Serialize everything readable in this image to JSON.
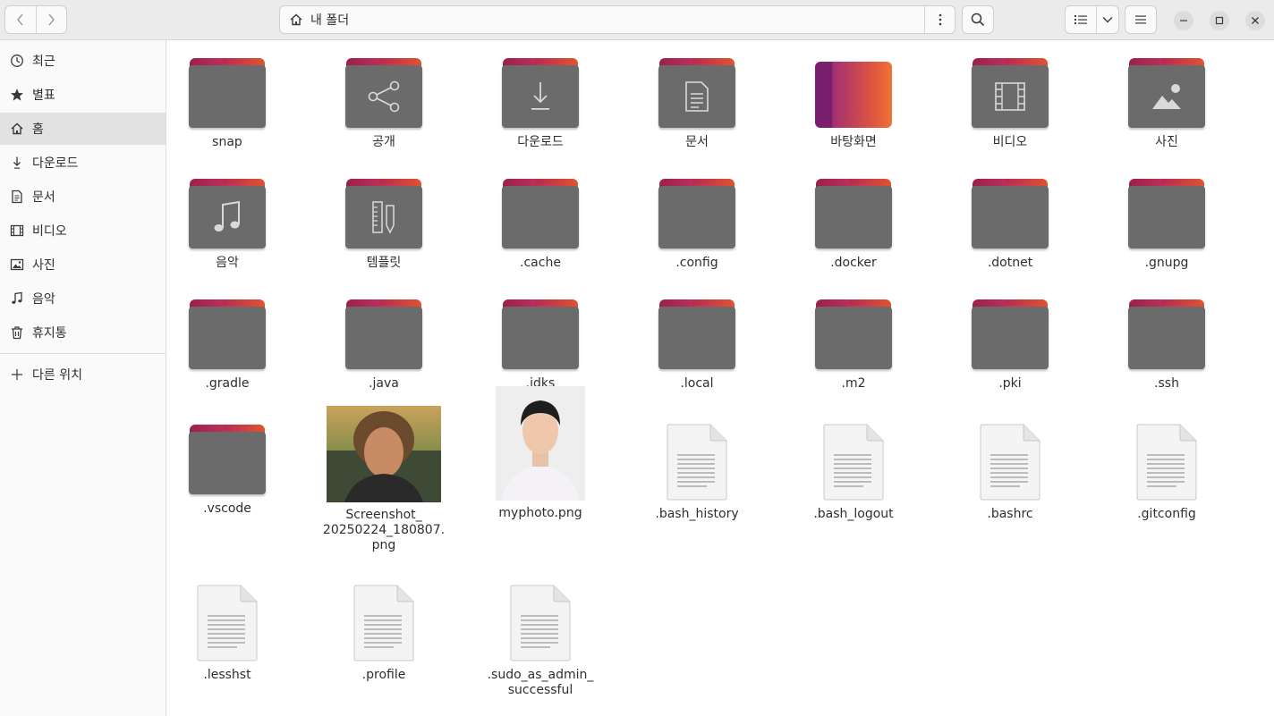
{
  "window": {
    "path_label": "내 폴더"
  },
  "sidebar": {
    "items": [
      {
        "label": "최근",
        "icon": "clock-icon"
      },
      {
        "label": "별표",
        "icon": "star-icon"
      },
      {
        "label": "홈",
        "icon": "home-icon"
      },
      {
        "label": "다운로드",
        "icon": "download-icon"
      },
      {
        "label": "문서",
        "icon": "document-icon"
      },
      {
        "label": "비디오",
        "icon": "video-icon"
      },
      {
        "label": "사진",
        "icon": "picture-icon"
      },
      {
        "label": "음악",
        "icon": "music-icon"
      },
      {
        "label": "휴지통",
        "icon": "trash-icon"
      }
    ],
    "other_locations": "다른 위치",
    "active_index": 2
  },
  "files": [
    {
      "name": "snap",
      "kind": "folder",
      "emblem": ""
    },
    {
      "name": "공개",
      "kind": "folder",
      "emblem": "share-icon"
    },
    {
      "name": "다운로드",
      "kind": "folder",
      "emblem": "download-icon"
    },
    {
      "name": "문서",
      "kind": "folder",
      "emblem": "document-icon"
    },
    {
      "name": "바탕화면",
      "kind": "desktop",
      "emblem": ""
    },
    {
      "name": "비디오",
      "kind": "folder",
      "emblem": "film-icon"
    },
    {
      "name": "사진",
      "kind": "folder",
      "emblem": "picture-icon"
    },
    {
      "name": "음악",
      "kind": "folder",
      "emblem": "music-icon"
    },
    {
      "name": "템플릿",
      "kind": "folder",
      "emblem": "template-icon"
    },
    {
      "name": ".cache",
      "kind": "folder",
      "emblem": ""
    },
    {
      "name": ".config",
      "kind": "folder",
      "emblem": ""
    },
    {
      "name": ".docker",
      "kind": "folder",
      "emblem": ""
    },
    {
      "name": ".dotnet",
      "kind": "folder",
      "emblem": ""
    },
    {
      "name": ".gnupg",
      "kind": "folder",
      "emblem": ""
    },
    {
      "name": ".gradle",
      "kind": "folder",
      "emblem": ""
    },
    {
      "name": ".java",
      "kind": "folder",
      "emblem": ""
    },
    {
      "name": ".jdks",
      "kind": "folder",
      "emblem": ""
    },
    {
      "name": ".local",
      "kind": "folder",
      "emblem": ""
    },
    {
      "name": ".m2",
      "kind": "folder",
      "emblem": ""
    },
    {
      "name": ".pki",
      "kind": "folder",
      "emblem": ""
    },
    {
      "name": ".ssh",
      "kind": "folder",
      "emblem": ""
    },
    {
      "name": ".vscode",
      "kind": "folder",
      "emblem": ""
    },
    {
      "name": "Screenshot_\n20250224_180807.\npng",
      "kind": "image1",
      "emblem": ""
    },
    {
      "name": "myphoto.png",
      "kind": "image2",
      "emblem": ""
    },
    {
      "name": ".bash_history",
      "kind": "text",
      "emblem": ""
    },
    {
      "name": ".bash_logout",
      "kind": "text",
      "emblem": ""
    },
    {
      "name": ".bashrc",
      "kind": "text",
      "emblem": ""
    },
    {
      "name": ".gitconfig",
      "kind": "text",
      "emblem": ""
    },
    {
      "name": ".lesshst",
      "kind": "text",
      "emblem": ""
    },
    {
      "name": ".profile",
      "kind": "text",
      "emblem": ""
    },
    {
      "name": ".sudo_as_admin_\nsuccessful",
      "kind": "text",
      "emblem": ""
    }
  ],
  "colors": {
    "folder_body": "#6b6b6b",
    "folder_tab_start": "#9b1f4f",
    "folder_tab_end": "#e0532f",
    "sidebar_active": "#e2e2e2"
  }
}
